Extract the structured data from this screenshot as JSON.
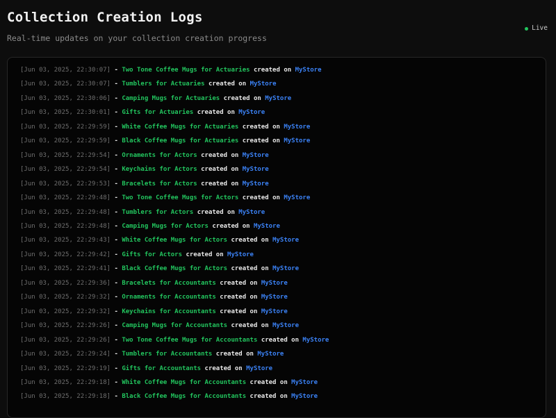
{
  "page": {
    "title": "Collection Creation Logs",
    "subtitle": "Real-time updates on your collection creation progress"
  },
  "live": {
    "label": "Live"
  },
  "colors": {
    "page_background": "#0d0d0d",
    "panel_background": "#050505",
    "panel_border": "#272727",
    "timestamp_gray": "#6f6f6f",
    "collection_green": "#22c55e",
    "created_white": "#e8e8e8",
    "store_blue": "#3b82f6",
    "live_dot_green": "#22c55e"
  },
  "log": {
    "separator": "-",
    "created_text": "created on",
    "entries": [
      {
        "timestamp": "[Jun 03, 2025, 22:30:07]",
        "collection": "Two Tone Coffee Mugs for Actuaries",
        "store": "MyStore"
      },
      {
        "timestamp": "[Jun 03, 2025, 22:30:07]",
        "collection": "Tumblers for Actuaries",
        "store": "MyStore"
      },
      {
        "timestamp": "[Jun 03, 2025, 22:30:06]",
        "collection": "Camping Mugs for Actuaries",
        "store": "MyStore"
      },
      {
        "timestamp": "[Jun 03, 2025, 22:30:01]",
        "collection": "Gifts for Actuaries",
        "store": "MyStore"
      },
      {
        "timestamp": "[Jun 03, 2025, 22:29:59]",
        "collection": "White Coffee Mugs for Actuaries",
        "store": "MyStore"
      },
      {
        "timestamp": "[Jun 03, 2025, 22:29:59]",
        "collection": "Black Coffee Mugs for Actuaries",
        "store": "MyStore"
      },
      {
        "timestamp": "[Jun 03, 2025, 22:29:54]",
        "collection": "Ornaments for Actors",
        "store": "MyStore"
      },
      {
        "timestamp": "[Jun 03, 2025, 22:29:54]",
        "collection": "Keychains for Actors",
        "store": "MyStore"
      },
      {
        "timestamp": "[Jun 03, 2025, 22:29:53]",
        "collection": "Bracelets for Actors",
        "store": "MyStore"
      },
      {
        "timestamp": "[Jun 03, 2025, 22:29:48]",
        "collection": "Two Tone Coffee Mugs for Actors",
        "store": "MyStore"
      },
      {
        "timestamp": "[Jun 03, 2025, 22:29:48]",
        "collection": "Tumblers for Actors",
        "store": "MyStore"
      },
      {
        "timestamp": "[Jun 03, 2025, 22:29:48]",
        "collection": "Camping Mugs for Actors",
        "store": "MyStore"
      },
      {
        "timestamp": "[Jun 03, 2025, 22:29:43]",
        "collection": "White Coffee Mugs for Actors",
        "store": "MyStore"
      },
      {
        "timestamp": "[Jun 03, 2025, 22:29:42]",
        "collection": "Gifts for Actors",
        "store": "MyStore"
      },
      {
        "timestamp": "[Jun 03, 2025, 22:29:41]",
        "collection": "Black Coffee Mugs for Actors",
        "store": "MyStore"
      },
      {
        "timestamp": "[Jun 03, 2025, 22:29:36]",
        "collection": "Bracelets for Accountants",
        "store": "MyStore"
      },
      {
        "timestamp": "[Jun 03, 2025, 22:29:32]",
        "collection": "Ornaments for Accountants",
        "store": "MyStore"
      },
      {
        "timestamp": "[Jun 03, 2025, 22:29:32]",
        "collection": "Keychains for Accountants",
        "store": "MyStore"
      },
      {
        "timestamp": "[Jun 03, 2025, 22:29:26]",
        "collection": "Camping Mugs for Accountants",
        "store": "MyStore"
      },
      {
        "timestamp": "[Jun 03, 2025, 22:29:26]",
        "collection": "Two Tone Coffee Mugs for Accountants",
        "store": "MyStore"
      },
      {
        "timestamp": "[Jun 03, 2025, 22:29:24]",
        "collection": "Tumblers for Accountants",
        "store": "MyStore"
      },
      {
        "timestamp": "[Jun 03, 2025, 22:29:19]",
        "collection": "Gifts for Accountants",
        "store": "MyStore"
      },
      {
        "timestamp": "[Jun 03, 2025, 22:29:18]",
        "collection": "White Coffee Mugs for Accountants",
        "store": "MyStore"
      },
      {
        "timestamp": "[Jun 03, 2025, 22:29:18]",
        "collection": "Black Coffee Mugs for Accountants",
        "store": "MyStore"
      }
    ]
  }
}
